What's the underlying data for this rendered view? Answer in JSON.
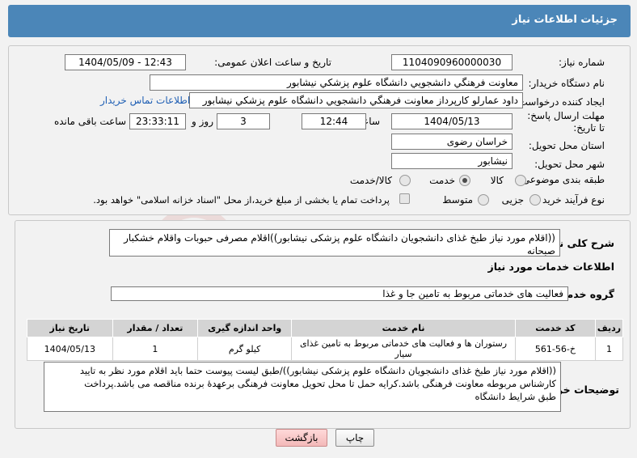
{
  "header": {
    "title": "جزئیات اطلاعات نیاز"
  },
  "form": {
    "need_number_label": "شماره نیاز:",
    "need_number": "1104090960000030",
    "announce_label": "تاریخ و ساعت اعلان عمومی:",
    "announce_value": "1404/05/09 - 12:43",
    "buyer_org_label": "نام دستگاه خریدار:",
    "buyer_org": "معاونت فرهنگي دانشجويي دانشگاه علوم پزشکي نيشابور",
    "creator_label": "ایجاد کننده درخواست:",
    "creator": "داود عمارلو کارپرداز معاونت فرهنگي دانشجويي دانشگاه علوم پزشکي نيشابور",
    "contact_link": "اطلاعات تماس خریدار",
    "deadline_label": "مهلت ارسال پاسخ: تا تاریخ:",
    "deadline_date": "1404/05/13",
    "time_label": "ساعت",
    "deadline_time": "12:44",
    "days_value": "3",
    "days_label": "روز و",
    "remaining_time": "23:33:11",
    "remaining_label": "ساعت باقی مانده",
    "province_label": "استان محل تحویل:",
    "province": "خراسان رضوی",
    "city_label": "شهر محل تحویل:",
    "city": "نیشابور",
    "category_label": "طبقه بندی موضوعی:",
    "category_options": [
      "کالا",
      "خدمت",
      "کالا/خدمت"
    ],
    "process_label": "نوع فرآیند خرید :",
    "process_options": [
      "جزیی",
      "متوسط"
    ],
    "treasury_note": "پرداخت تمام یا بخشی از مبلغ خرید،از محل \"اسناد خزانه اسلامی\" خواهد بود."
  },
  "summary": {
    "label": "شرح کلی نیاز:",
    "text": "((اقلام مورد نیاز طبخ غذای دانشجویان دانشگاه علوم پزشکی نیشابور))اقلام مصرفی حبوبات واقلام خشکبار صبحانه"
  },
  "services": {
    "section_title": "اطلاعات خدمات مورد نیاز",
    "group_label": "گروه خدمت:",
    "group_value": "فعالیت های خدماتی مربوط به تامین جا و غذا",
    "columns": [
      "ردیف",
      "کد خدمت",
      "نام خدمت",
      "واحد اندازه گیری",
      "تعداد / مقدار",
      "تاریخ نیاز"
    ],
    "rows": [
      {
        "row": "1",
        "code": "خ-56-561",
        "name": "رستوران ها و فعالیت های خدماتی مربوط به تامین غذای سیار",
        "unit": "کیلو گرم",
        "qty": "1",
        "date": "1404/05/13"
      }
    ]
  },
  "buyer_notes": {
    "label": "توضیحات خریدار:",
    "line1": "((اقلام مورد نیاز طبخ غذای دانشجویان دانشگاه علوم پزشکی نیشابور))/طبق لیست پیوست حتما باید اقلام مورد نظر به تایید",
    "line2": "کارشناس مربوطه معاونت فرهنگی باشد.کرایه حمل تا محل تحویل معاونت فرهنگی برعهدهٔ برنده مناقصه می باشد.پرداخت",
    "line3": "طبق شرایط دانشگاه"
  },
  "buttons": {
    "print": "چاپ",
    "back": "بازگشت"
  },
  "watermark": {
    "text": "AriaTender.net"
  }
}
